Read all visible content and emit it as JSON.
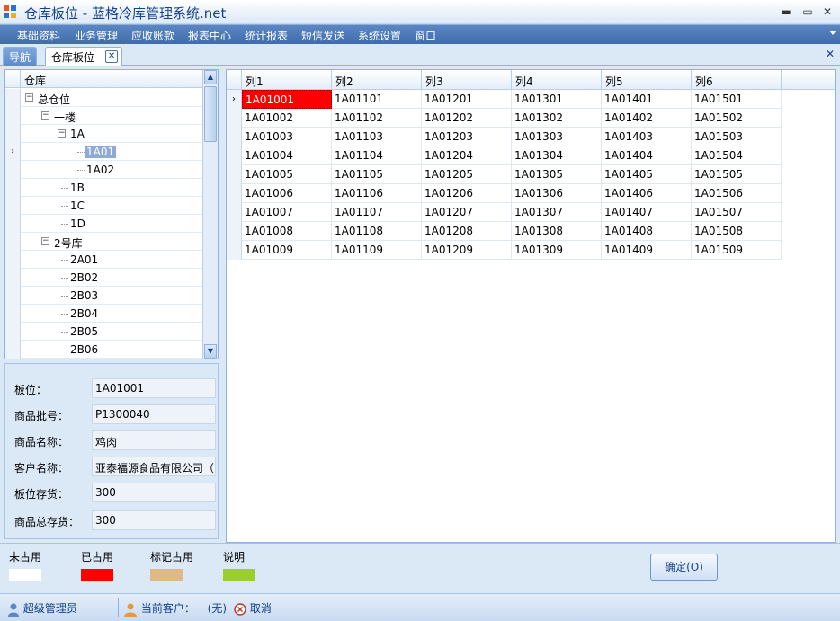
{
  "window": {
    "title": "仓库板位 - 蓝格冷库管理系统.net",
    "minimize": "▬",
    "maximize": "▭",
    "close": "✕"
  },
  "menu": [
    "基础资料",
    "业务管理",
    "应收账款",
    "报表中心",
    "统计报表",
    "短信发送",
    "系统设置",
    "窗口"
  ],
  "tabs": {
    "nav": "导航",
    "active": "仓库板位",
    "close_glyph": "✕",
    "close_all_glyph": "✕"
  },
  "tree": {
    "header": "仓库",
    "nodes": [
      {
        "label": "总仓位",
        "level": 0,
        "expander": "−"
      },
      {
        "label": "一楼",
        "level": 1,
        "expander": "−"
      },
      {
        "label": "1A",
        "level": 2,
        "expander": "−"
      },
      {
        "label": "1A01",
        "level": 3,
        "selected": true
      },
      {
        "label": "1A02",
        "level": 3
      },
      {
        "label": "1B",
        "level": 2
      },
      {
        "label": "1C",
        "level": 2
      },
      {
        "label": "1D",
        "level": 2
      },
      {
        "label": "2号库",
        "level": 1,
        "expander": "−"
      },
      {
        "label": "2A01",
        "level": 2
      },
      {
        "label": "2B02",
        "level": 2
      },
      {
        "label": "2B03",
        "level": 2
      },
      {
        "label": "2B04",
        "level": 2
      },
      {
        "label": "2B05",
        "level": 2
      },
      {
        "label": "2B06",
        "level": 2
      }
    ],
    "current_row_marker": "›"
  },
  "details": [
    {
      "label": "板位：",
      "value": "1A01001"
    },
    {
      "label": "商品批号：",
      "value": "P1300040"
    },
    {
      "label": "商品名称：",
      "value": "鸡肉"
    },
    {
      "label": "客户名称：",
      "value": "亚泰福源食品有限公司（"
    },
    {
      "label": "板位存货：",
      "value": "300"
    },
    {
      "label": "商品总存货：",
      "value": "300"
    }
  ],
  "grid": {
    "columns": [
      "列1",
      "列2",
      "列3",
      "列4",
      "列5",
      "列6"
    ],
    "rows": [
      [
        "1A01001",
        "1A01101",
        "1A01201",
        "1A01301",
        "1A01401",
        "1A01501"
      ],
      [
        "1A01002",
        "1A01102",
        "1A01202",
        "1A01302",
        "1A01402",
        "1A01502"
      ],
      [
        "1A01003",
        "1A01103",
        "1A01203",
        "1A01303",
        "1A01403",
        "1A01503"
      ],
      [
        "1A01004",
        "1A01104",
        "1A01204",
        "1A01304",
        "1A01404",
        "1A01504"
      ],
      [
        "1A01005",
        "1A01105",
        "1A01205",
        "1A01305",
        "1A01405",
        "1A01505"
      ],
      [
        "1A01006",
        "1A01106",
        "1A01206",
        "1A01306",
        "1A01406",
        "1A01506"
      ],
      [
        "1A01007",
        "1A01107",
        "1A01207",
        "1A01307",
        "1A01407",
        "1A01507"
      ],
      [
        "1A01008",
        "1A01108",
        "1A01208",
        "1A01308",
        "1A01408",
        "1A01508"
      ],
      [
        "1A01009",
        "1A01109",
        "1A01209",
        "1A01309",
        "1A01409",
        "1A01509"
      ]
    ],
    "occupied": [
      [
        0,
        0
      ]
    ],
    "current_row_marker": "›"
  },
  "legend": [
    {
      "label": "未占用",
      "color": "#ffffff"
    },
    {
      "label": "已占用",
      "color": "#ff0000"
    },
    {
      "label": "标记占用",
      "color": "#deb887"
    },
    {
      "label": "说明",
      "color": "#9acd32"
    }
  ],
  "ok_button": "确定(O)",
  "status": {
    "user": "超级管理员",
    "customer_label": "当前客户：",
    "customer_value": "(无)",
    "cancel": "取消"
  },
  "colors": {
    "accent": "#15428b",
    "menubar": "#4a76b5",
    "selected_node": "#8fa9d8",
    "occupied": "#ff0000"
  }
}
